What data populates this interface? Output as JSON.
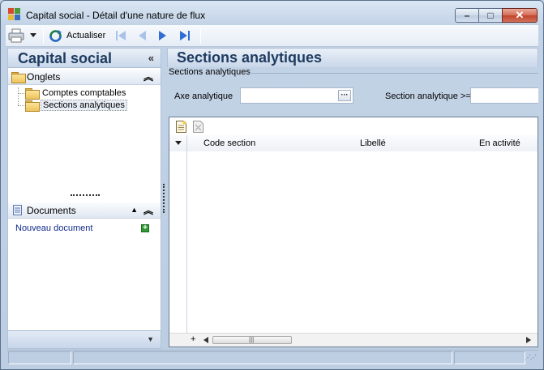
{
  "window": {
    "title": "Capital social -  Détail d'une nature de flux",
    "minimize_glyph": "–",
    "maximize_glyph": "□",
    "close_glyph": "✕"
  },
  "toolbar": {
    "print_icon": "printer-icon",
    "refresh_label": "Actualiser"
  },
  "left_panel": {
    "title": "Capital social",
    "onglets": {
      "label": "Onglets",
      "items": [
        {
          "label": "Comptes comptables",
          "selected": false
        },
        {
          "label": "Sections analytiques",
          "selected": true
        }
      ]
    },
    "documents": {
      "label": "Documents",
      "new_document": "Nouveau document"
    }
  },
  "main": {
    "title": "Sections analytiques",
    "group_title": "Sections analytiques",
    "filters": {
      "axe_label": "Axe analytique",
      "axe_value": "",
      "section_label": "Section analytique >=",
      "section_value": ""
    },
    "grid": {
      "columns": [
        "Code section",
        "Libellé",
        "En activité"
      ],
      "rows": []
    }
  },
  "colors": {
    "header_text": "#1e3b60",
    "link": "#102a8c",
    "accent_green": "#2f9a35"
  }
}
